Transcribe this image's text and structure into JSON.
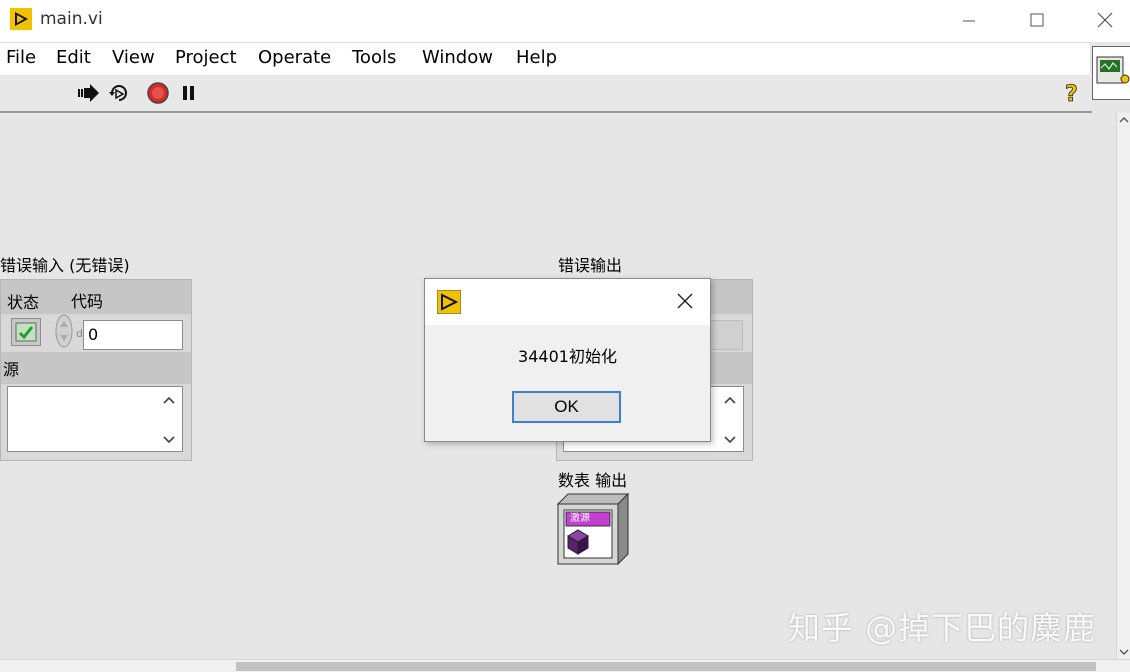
{
  "window": {
    "title": "main.vi"
  },
  "menubar": {
    "items": [
      "File",
      "Edit",
      "View",
      "Project",
      "Operate",
      "Tools",
      "Window",
      "Help"
    ]
  },
  "error_in": {
    "label": "错误输入 (无错误)",
    "status_label": "状态",
    "code_label": "代码",
    "code_value": "0",
    "radix": "d",
    "source_label": "源"
  },
  "error_out": {
    "label": "错误输出"
  },
  "meter_out": {
    "label": "数表 输出",
    "icon_text": "激源"
  },
  "dialog": {
    "message": "34401初始化",
    "ok_label": "OK"
  },
  "watermark": "知乎 @掉下巴的麋鹿",
  "colors": {
    "labview_yellow": "#f2c200",
    "ok_focus": "#3c7fd6",
    "status_green": "#2e9a2e",
    "stop_red": "#d42a2a",
    "meter_purple": "#7a1f8f"
  },
  "icons": [
    "run-arrow-icon",
    "run-continuously-icon",
    "abort-icon",
    "pause-icon",
    "context-help-icon"
  ]
}
